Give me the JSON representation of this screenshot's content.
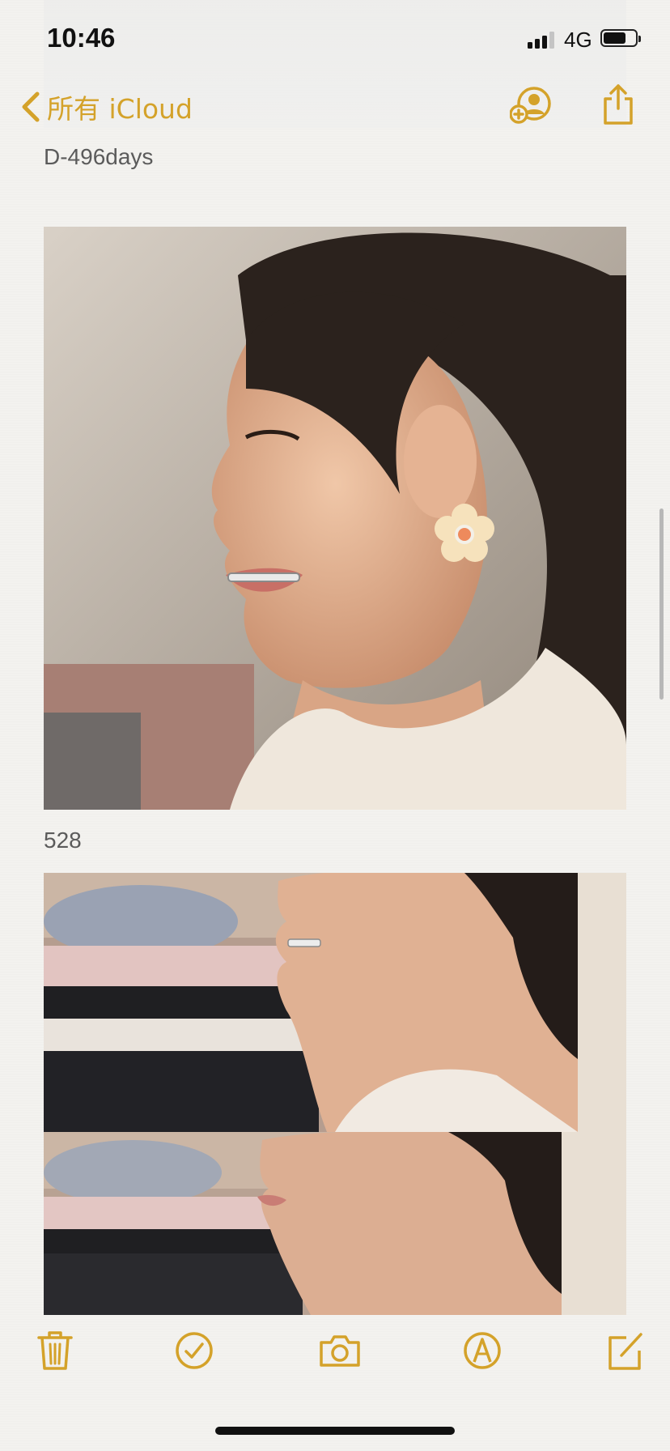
{
  "status": {
    "time": "10:46",
    "network": "4G",
    "battery_level": 0.7
  },
  "nav": {
    "back_label": "所有 iCloud",
    "icons": [
      "chevron-left-icon",
      "add-person-icon",
      "share-icon"
    ]
  },
  "note": {
    "heading": "D-496days",
    "caption": "528"
  },
  "toolbar": {
    "icons": [
      "trash-icon",
      "checklist-icon",
      "camera-icon",
      "markup-icon",
      "compose-icon"
    ]
  },
  "colors": {
    "accent": "#D4A22A",
    "text_secondary": "#5B5B5B",
    "background": "#F3F2EF"
  }
}
